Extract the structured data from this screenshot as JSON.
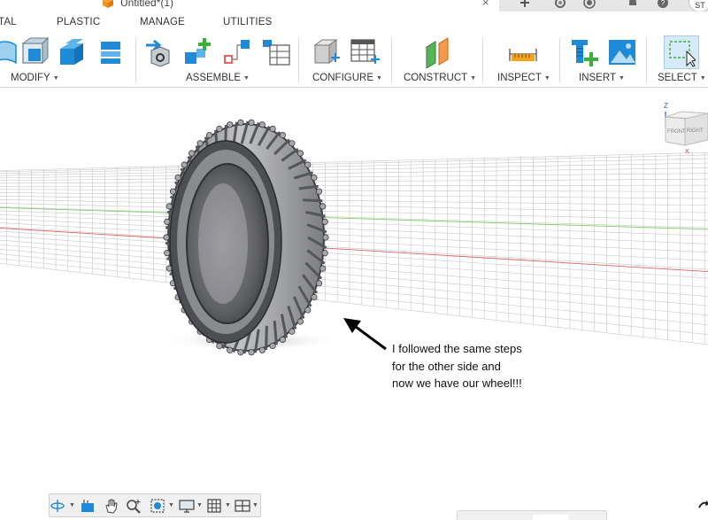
{
  "window": {
    "document_title": "Untitled*(1)",
    "close_glyph": "×",
    "user_initials": "ST"
  },
  "tabs": [
    "TAL",
    "PLASTIC",
    "MANAGE",
    "UTILITIES"
  ],
  "ribbon": {
    "groups": [
      {
        "label": "MODIFY"
      },
      {
        "label": "ASSEMBLE"
      },
      {
        "label": "CONFIGURE"
      },
      {
        "label": "CONSTRUCT"
      },
      {
        "label": "INSPECT"
      },
      {
        "label": "INSERT"
      },
      {
        "label": "SELECT"
      }
    ],
    "caret": "▼"
  },
  "annotation": {
    "lines": [
      "I followed the same steps",
      "for the other side and",
      "now we have our wheel!!!"
    ]
  },
  "viewcube": {
    "front": "FRONT",
    "right": "RIGHT",
    "z_axis": "Z",
    "x_axis": "X"
  },
  "colors": {
    "accent_orange": "#f5901e",
    "accent_blue": "#1f8bd8",
    "accent_green": "#3cae3e",
    "tire_dark": "#55565a",
    "tire_light": "#a8a9ad",
    "grid_line": "#c8c8c8",
    "axis_red": "#e06060",
    "axis_green": "#7fce6a",
    "select_highlight": "#d6eaf8"
  },
  "icons": {
    "titlebar": [
      "fusion-cube-icon",
      "close-icon",
      "plus-icon",
      "refresh-icon",
      "job-status-icon",
      "bell-icon",
      "help-icon"
    ],
    "navbar": [
      "orbit-icon",
      "look-at-icon",
      "pan-icon",
      "zoom-icon",
      "fit-icon",
      "display-settings-icon",
      "grid-icon",
      "viewports-icon"
    ]
  }
}
